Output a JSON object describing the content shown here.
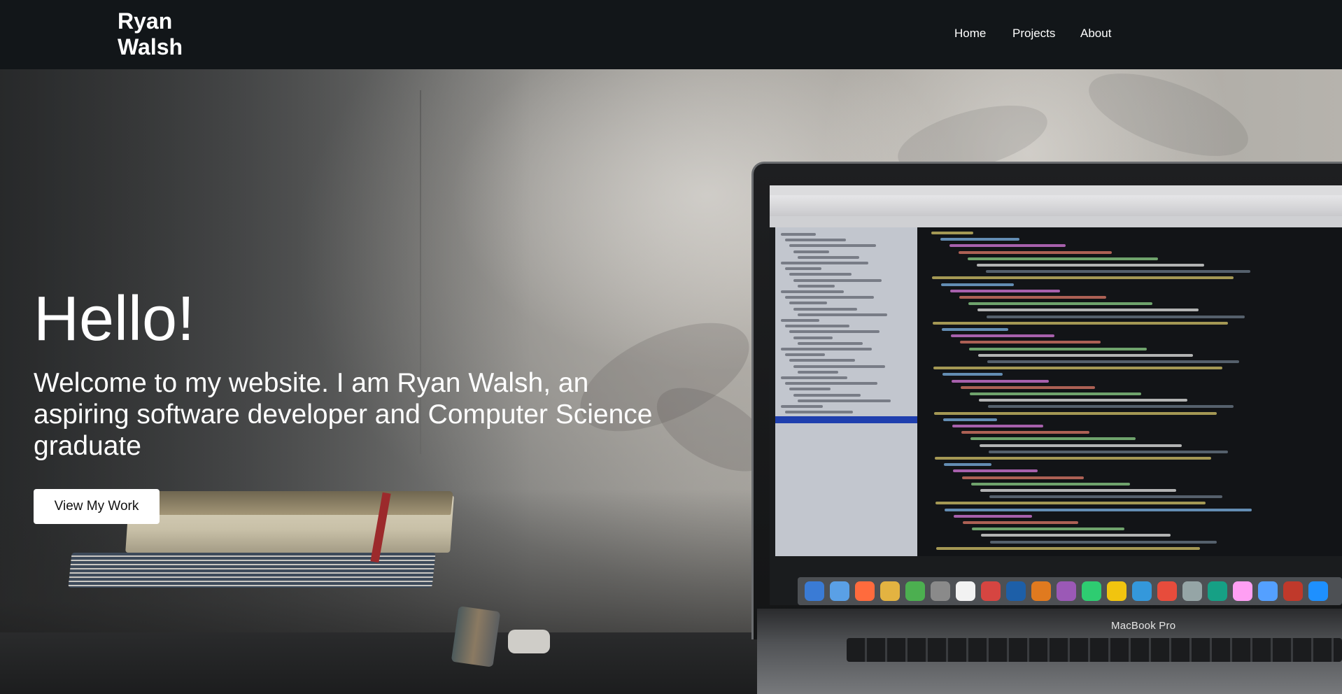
{
  "navbar": {
    "brand": "Ryan Walsh",
    "links": [
      {
        "label": "Home"
      },
      {
        "label": "Projects"
      },
      {
        "label": "About"
      }
    ]
  },
  "hero": {
    "title": "Hello!",
    "subtitle": "Welcome to my website. I am Ryan Walsh, an aspiring software developer and Computer Science graduate",
    "cta_label": "View My Work",
    "background_brand_text": "MacBook Pro"
  },
  "colors": {
    "navbar_bg": "#121619",
    "text": "#ffffff",
    "button_bg": "#ffffff",
    "button_text": "#111111"
  }
}
